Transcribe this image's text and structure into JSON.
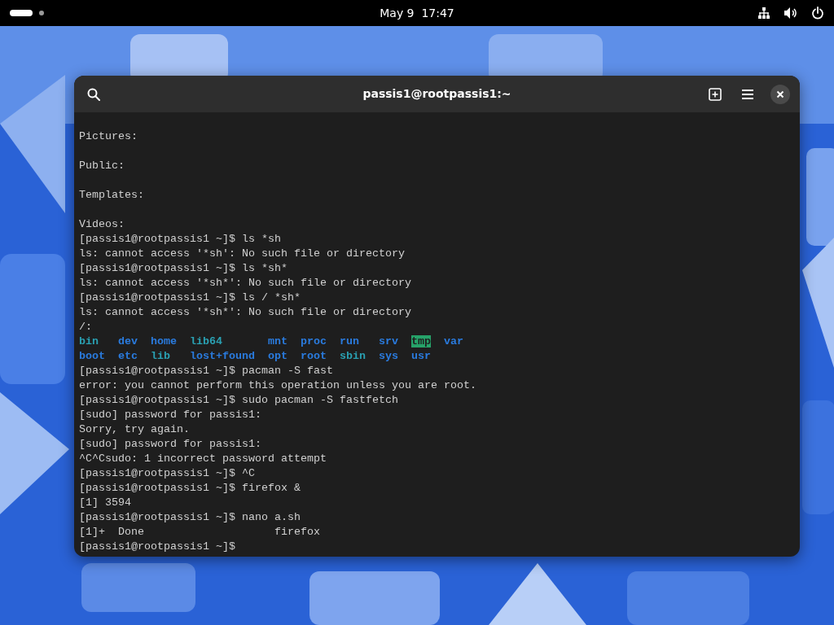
{
  "top_bar": {
    "workspaces": [
      {
        "selected": true
      },
      {
        "selected": false
      }
    ],
    "clock": "May 9  17:47"
  },
  "window": {
    "title": "passis1@rootpassis1:~"
  },
  "terminal": {
    "lines": [
      {
        "kind": "blank"
      },
      {
        "kind": "text",
        "text": "Pictures:"
      },
      {
        "kind": "blank"
      },
      {
        "kind": "text",
        "text": "Public:"
      },
      {
        "kind": "blank"
      },
      {
        "kind": "text",
        "text": "Templates:"
      },
      {
        "kind": "blank"
      },
      {
        "kind": "text",
        "text": "Videos:"
      },
      {
        "kind": "text",
        "text": "[passis1@rootpassis1 ~]$ ls *sh"
      },
      {
        "kind": "text",
        "text": "ls: cannot access '*sh': No such file or directory"
      },
      {
        "kind": "text",
        "text": "[passis1@rootpassis1 ~]$ ls *sh*"
      },
      {
        "kind": "text",
        "text": "ls: cannot access '*sh*': No such file or directory"
      },
      {
        "kind": "text",
        "text": "[passis1@rootpassis1 ~]$ ls / *sh*"
      },
      {
        "kind": "text",
        "text": "ls: cannot access '*sh*': No such file or directory"
      },
      {
        "kind": "text",
        "text": "/:"
      },
      {
        "kind": "listing",
        "rows": [
          [
            {
              "name": "bin",
              "kind": "link"
            },
            {
              "name": "dev",
              "kind": "dir"
            },
            {
              "name": "home",
              "kind": "dir"
            },
            {
              "name": "lib64",
              "kind": "link"
            },
            {
              "name": "mnt",
              "kind": "dir"
            },
            {
              "name": "proc",
              "kind": "dir"
            },
            {
              "name": "run",
              "kind": "dir"
            },
            {
              "name": "srv",
              "kind": "dir"
            },
            {
              "name": "tmp",
              "kind": "sticky"
            },
            {
              "name": "var",
              "kind": "dir"
            }
          ],
          [
            {
              "name": "boot",
              "kind": "dir"
            },
            {
              "name": "etc",
              "kind": "dir"
            },
            {
              "name": "lib",
              "kind": "link"
            },
            {
              "name": "lost+found",
              "kind": "dir"
            },
            {
              "name": "opt",
              "kind": "dir"
            },
            {
              "name": "root",
              "kind": "dir"
            },
            {
              "name": "sbin",
              "kind": "link"
            },
            {
              "name": "sys",
              "kind": "dir"
            },
            {
              "name": "usr",
              "kind": "dir"
            }
          ]
        ]
      },
      {
        "kind": "text",
        "text": "[passis1@rootpassis1 ~]$ pacman -S fast"
      },
      {
        "kind": "text",
        "text": "error: you cannot perform this operation unless you are root."
      },
      {
        "kind": "text",
        "text": "[passis1@rootpassis1 ~]$ sudo pacman -S fastfetch"
      },
      {
        "kind": "text",
        "text": "[sudo] password for passis1:"
      },
      {
        "kind": "text",
        "text": "Sorry, try again."
      },
      {
        "kind": "text",
        "text": "[sudo] password for passis1:"
      },
      {
        "kind": "text",
        "text": "^C^Csudo: 1 incorrect password attempt"
      },
      {
        "kind": "text",
        "text": "[passis1@rootpassis1 ~]$ ^C"
      },
      {
        "kind": "text",
        "text": "[passis1@rootpassis1 ~]$ firefox &"
      },
      {
        "kind": "text",
        "text": "[1] 3594"
      },
      {
        "kind": "text",
        "text": "[passis1@rootpassis1 ~]$ nano a.sh"
      },
      {
        "kind": "text",
        "text": "[1]+  Done                    firefox"
      },
      {
        "kind": "text",
        "text": "[passis1@rootpassis1 ~]$"
      }
    ]
  }
}
